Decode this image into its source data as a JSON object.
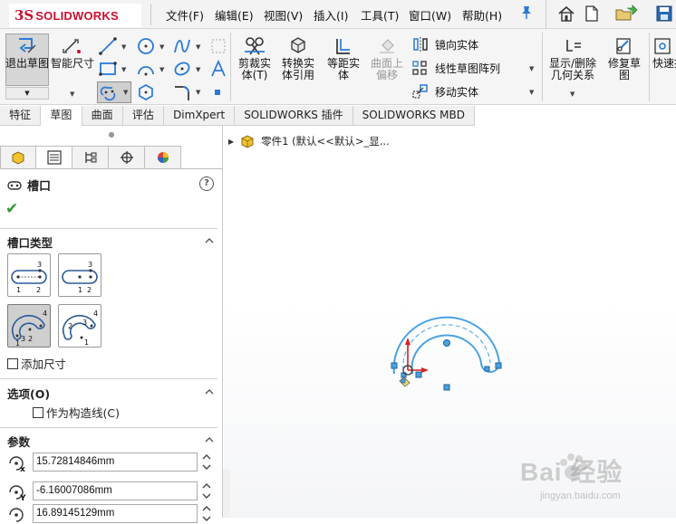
{
  "app": {
    "logo_prefix": "3S",
    "logo_text": "SOLIDWORKS"
  },
  "menu": [
    {
      "label": "文件(F)"
    },
    {
      "label": "编辑(E)"
    },
    {
      "label": "视图(V)"
    },
    {
      "label": "插入(I)"
    },
    {
      "label": "工具(T)"
    },
    {
      "label": "窗口(W)"
    },
    {
      "label": "帮助(H)"
    }
  ],
  "commands": {
    "exit_sketch": "退出草图",
    "smart_dim": "智能尺寸",
    "trim": "剪裁实体(T)",
    "convert": "转换实体引用",
    "offset": "等距实体",
    "surface_offset": "曲面上偏移",
    "mirror": "镜向实体",
    "linear_pattern": "线性草图阵列",
    "move": "移动实体",
    "show_relations": "显示/删除几何关系",
    "repair": "修复草图",
    "quick": "快速提"
  },
  "tabs": [
    {
      "label": "特征"
    },
    {
      "label": "草图"
    },
    {
      "label": "曲面"
    },
    {
      "label": "评估"
    },
    {
      "label": "DimXpert"
    },
    {
      "label": "SOLIDWORKS 插件"
    },
    {
      "label": "SOLIDWORKS MBD"
    }
  ],
  "property_manager": {
    "title": "槽口",
    "help": "?",
    "ok_symbol": "✔",
    "slot_type_title": "槽口类型",
    "add_dimensions": "添加尺寸",
    "options_title": "选项(O)",
    "construction": "作为构造线(C)",
    "params_title": "参数",
    "params": [
      {
        "value": "15.72814846mm"
      },
      {
        "value": "-6.16007086mm"
      },
      {
        "value": "16.89145129mm"
      }
    ],
    "slot_icon_numbers": {
      "one": "1",
      "two": "2",
      "three": "3",
      "four": "4"
    },
    "param_axis_labels": {
      "x": "x",
      "y": "Y"
    }
  },
  "tree": {
    "label": "零件1  (默认<<默认>_显..."
  },
  "watermark": {
    "main": "Bai 经验",
    "sub": "jingyan.baidu.com"
  },
  "colors": {
    "accent": "#2a7ad6",
    "sketch_blue": "#4aa3e0",
    "ok_green": "#2e9b2e",
    "logo_red": "#c8102e"
  }
}
